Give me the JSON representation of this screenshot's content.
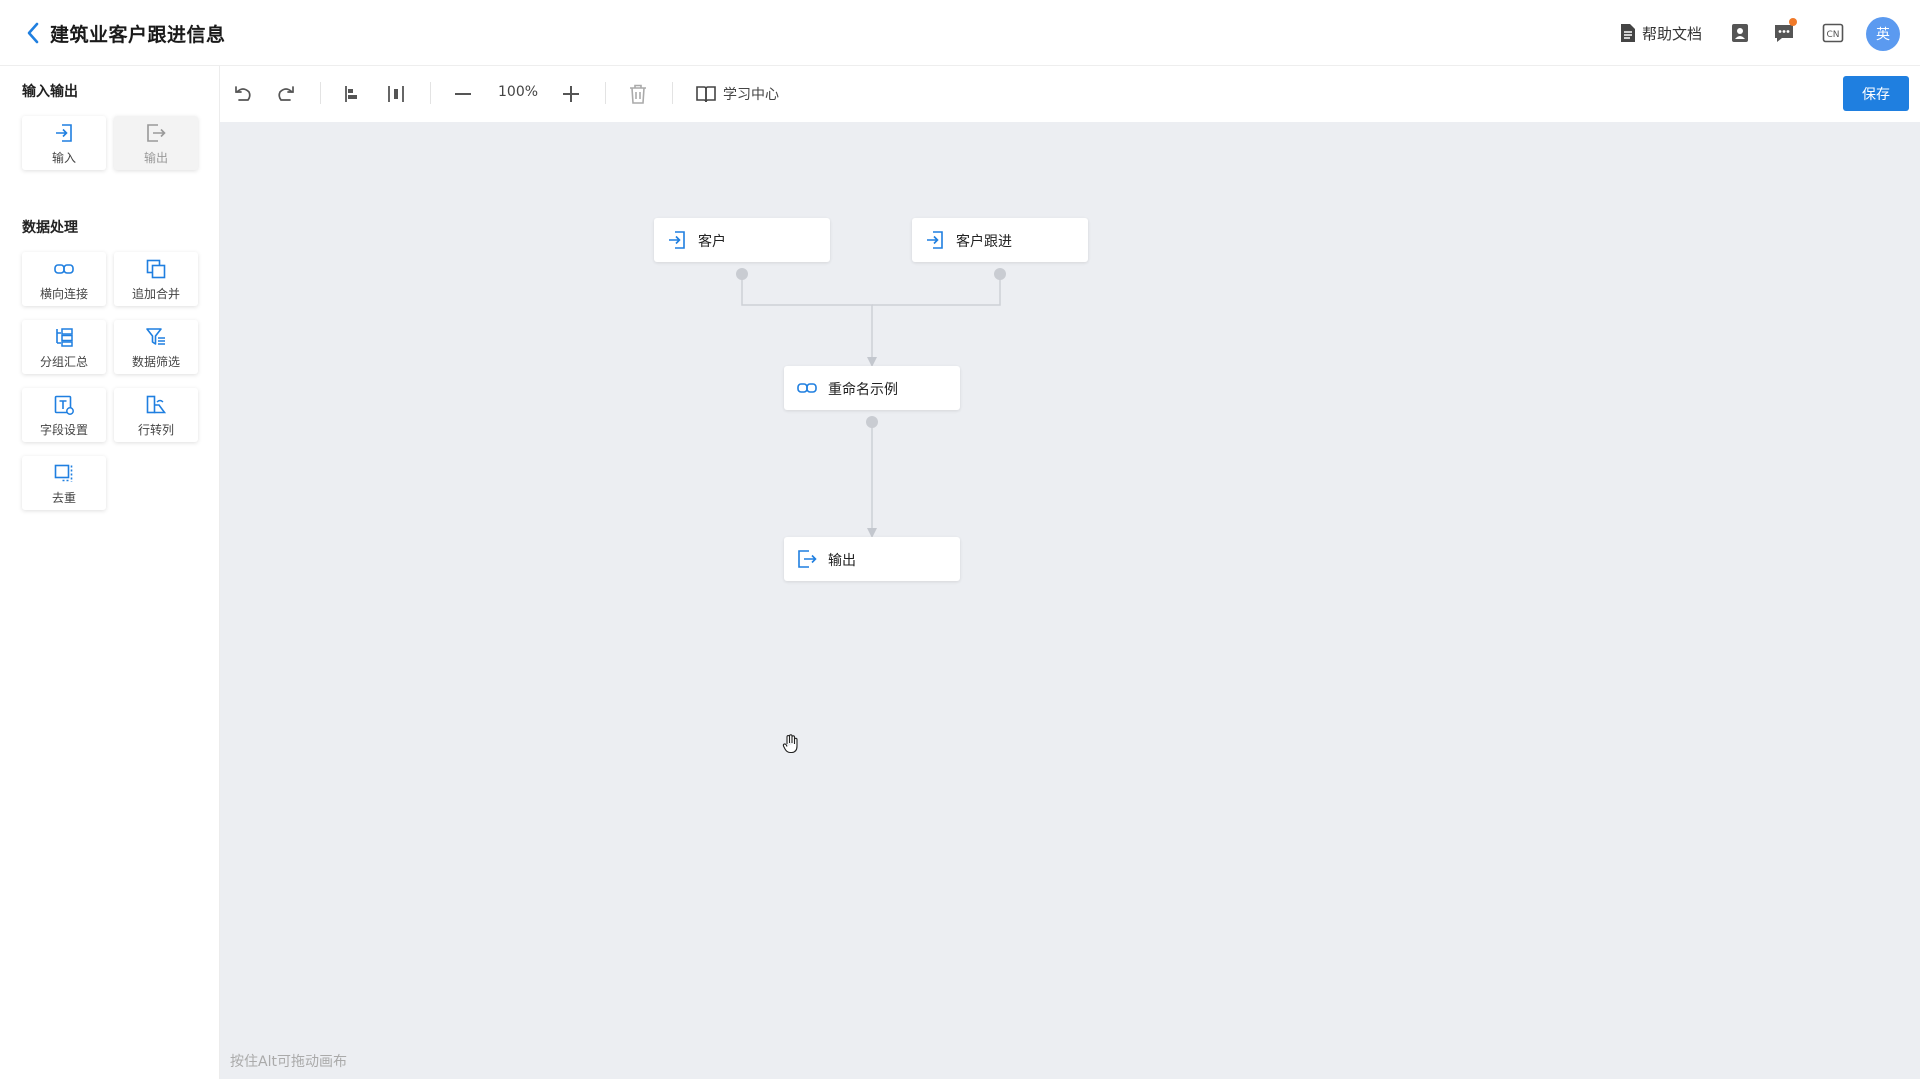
{
  "header": {
    "title": "建筑业客户跟进信息",
    "help_doc_label": "帮助文档",
    "avatar_text": "英",
    "lang_badge": "CN"
  },
  "toolbar": {
    "zoom": "100%",
    "learn_center_label": "学习中心",
    "save_label": "保存"
  },
  "sidebar": {
    "io_section_title": "输入输出",
    "io_items": [
      {
        "label": "输入",
        "icon": "input-icon",
        "enabled": true
      },
      {
        "label": "输出",
        "icon": "output-icon",
        "enabled": false
      }
    ],
    "processing_section_title": "数据处理",
    "processing_items": [
      {
        "label": "横向连接",
        "icon": "link-icon"
      },
      {
        "label": "追加合并",
        "icon": "copy-icon"
      },
      {
        "label": "分组汇总",
        "icon": "group-icon"
      },
      {
        "label": "数据筛选",
        "icon": "filter-icon"
      },
      {
        "label": "字段设置",
        "icon": "text-field-icon"
      },
      {
        "label": "行转列",
        "icon": "row-to-column-icon"
      },
      {
        "label": "去重",
        "icon": "dedupe-icon"
      }
    ]
  },
  "canvas": {
    "hint": "按住Alt可拖动画布",
    "nodes": [
      {
        "id": "n1",
        "label": "客户",
        "icon": "input-icon"
      },
      {
        "id": "n2",
        "label": "客户跟进",
        "icon": "input-icon"
      },
      {
        "id": "n3",
        "label": "重命名示例",
        "icon": "link-icon"
      },
      {
        "id": "n4",
        "label": "输出",
        "icon": "output-icon"
      }
    ]
  },
  "colors": {
    "accent": "#1f7fe0",
    "canvas_bg": "#eceef2",
    "notification": "#f07a2a",
    "avatar": "#5b9af0"
  }
}
